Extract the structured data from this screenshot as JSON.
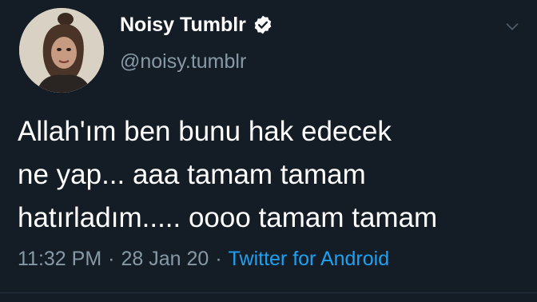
{
  "tweet": {
    "display_name": "Noisy Tumblr",
    "handle": "@noisy.tumblr",
    "verified": true,
    "text": "Allah'ım ben bunu hak edecek\nne yap... aaa tamam tamam\nhatırladım..... oooo tamam tamam",
    "time": "11:32 PM",
    "separator": "·",
    "date": "28 Jan 20",
    "source": "Twitter for Android"
  },
  "icons": {
    "verified_badge": "verified-badge-icon",
    "more_menu": "chevron-down-icon",
    "avatar": "avatar"
  },
  "colors": {
    "background": "#141d26",
    "primary_text": "#ffffff",
    "secondary_text": "#8899a6",
    "link": "#1da1f2"
  }
}
